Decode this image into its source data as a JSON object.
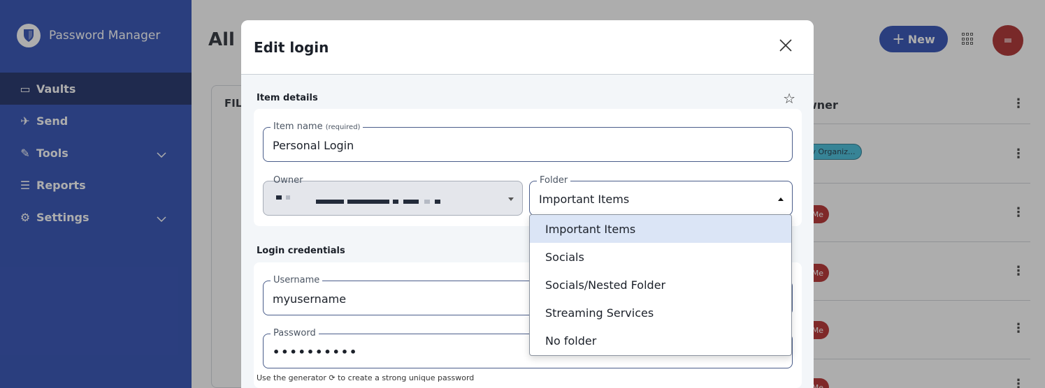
{
  "sidebar": {
    "brand": "Password Manager",
    "items": [
      {
        "label": "Vaults",
        "icon": "vault-icon",
        "glyph": "▭"
      },
      {
        "label": "Send",
        "icon": "send-icon",
        "glyph": "✈"
      },
      {
        "label": "Tools",
        "icon": "tools-icon",
        "glyph": "✎"
      },
      {
        "label": "Reports",
        "icon": "reports-icon",
        "glyph": "☰"
      },
      {
        "label": "Settings",
        "icon": "settings-icon",
        "glyph": "⚙"
      }
    ],
    "chevron": "⌵"
  },
  "header": {
    "title": "All",
    "new_label": "New",
    "new_glyph": "+"
  },
  "filters": {
    "title": "FIL"
  },
  "table": {
    "owner_header": "wner",
    "kebab": "⋮",
    "org_badge": "My Organiz...",
    "me_badge": "Me"
  },
  "dialog": {
    "title": "Edit login",
    "close_glyph": "✕",
    "item_details_title": "Item details",
    "star_glyph": "☆",
    "item_name_label": "Item name",
    "item_name_required": "(required)",
    "item_name_value": "Personal Login",
    "owner_label": "Owner",
    "folder_label": "Folder",
    "folder_value": "Important Items",
    "login_credentials_title": "Login credentials",
    "username_label": "Username",
    "username_value": "myusername",
    "password_label": "Password",
    "password_value": "••••••••••",
    "generator_hint": "Use the generator ⟳ to create a strong unique password"
  },
  "folder_options": [
    "Important Items",
    "Socials",
    "Socials/Nested Folder",
    "Streaming Services",
    "No folder"
  ],
  "colors": {
    "brand": "#1e40af",
    "sidebar_active": "#0c1e5c",
    "avatar": "#a61c1c",
    "dropdown_selected": "#dbe5f6"
  }
}
